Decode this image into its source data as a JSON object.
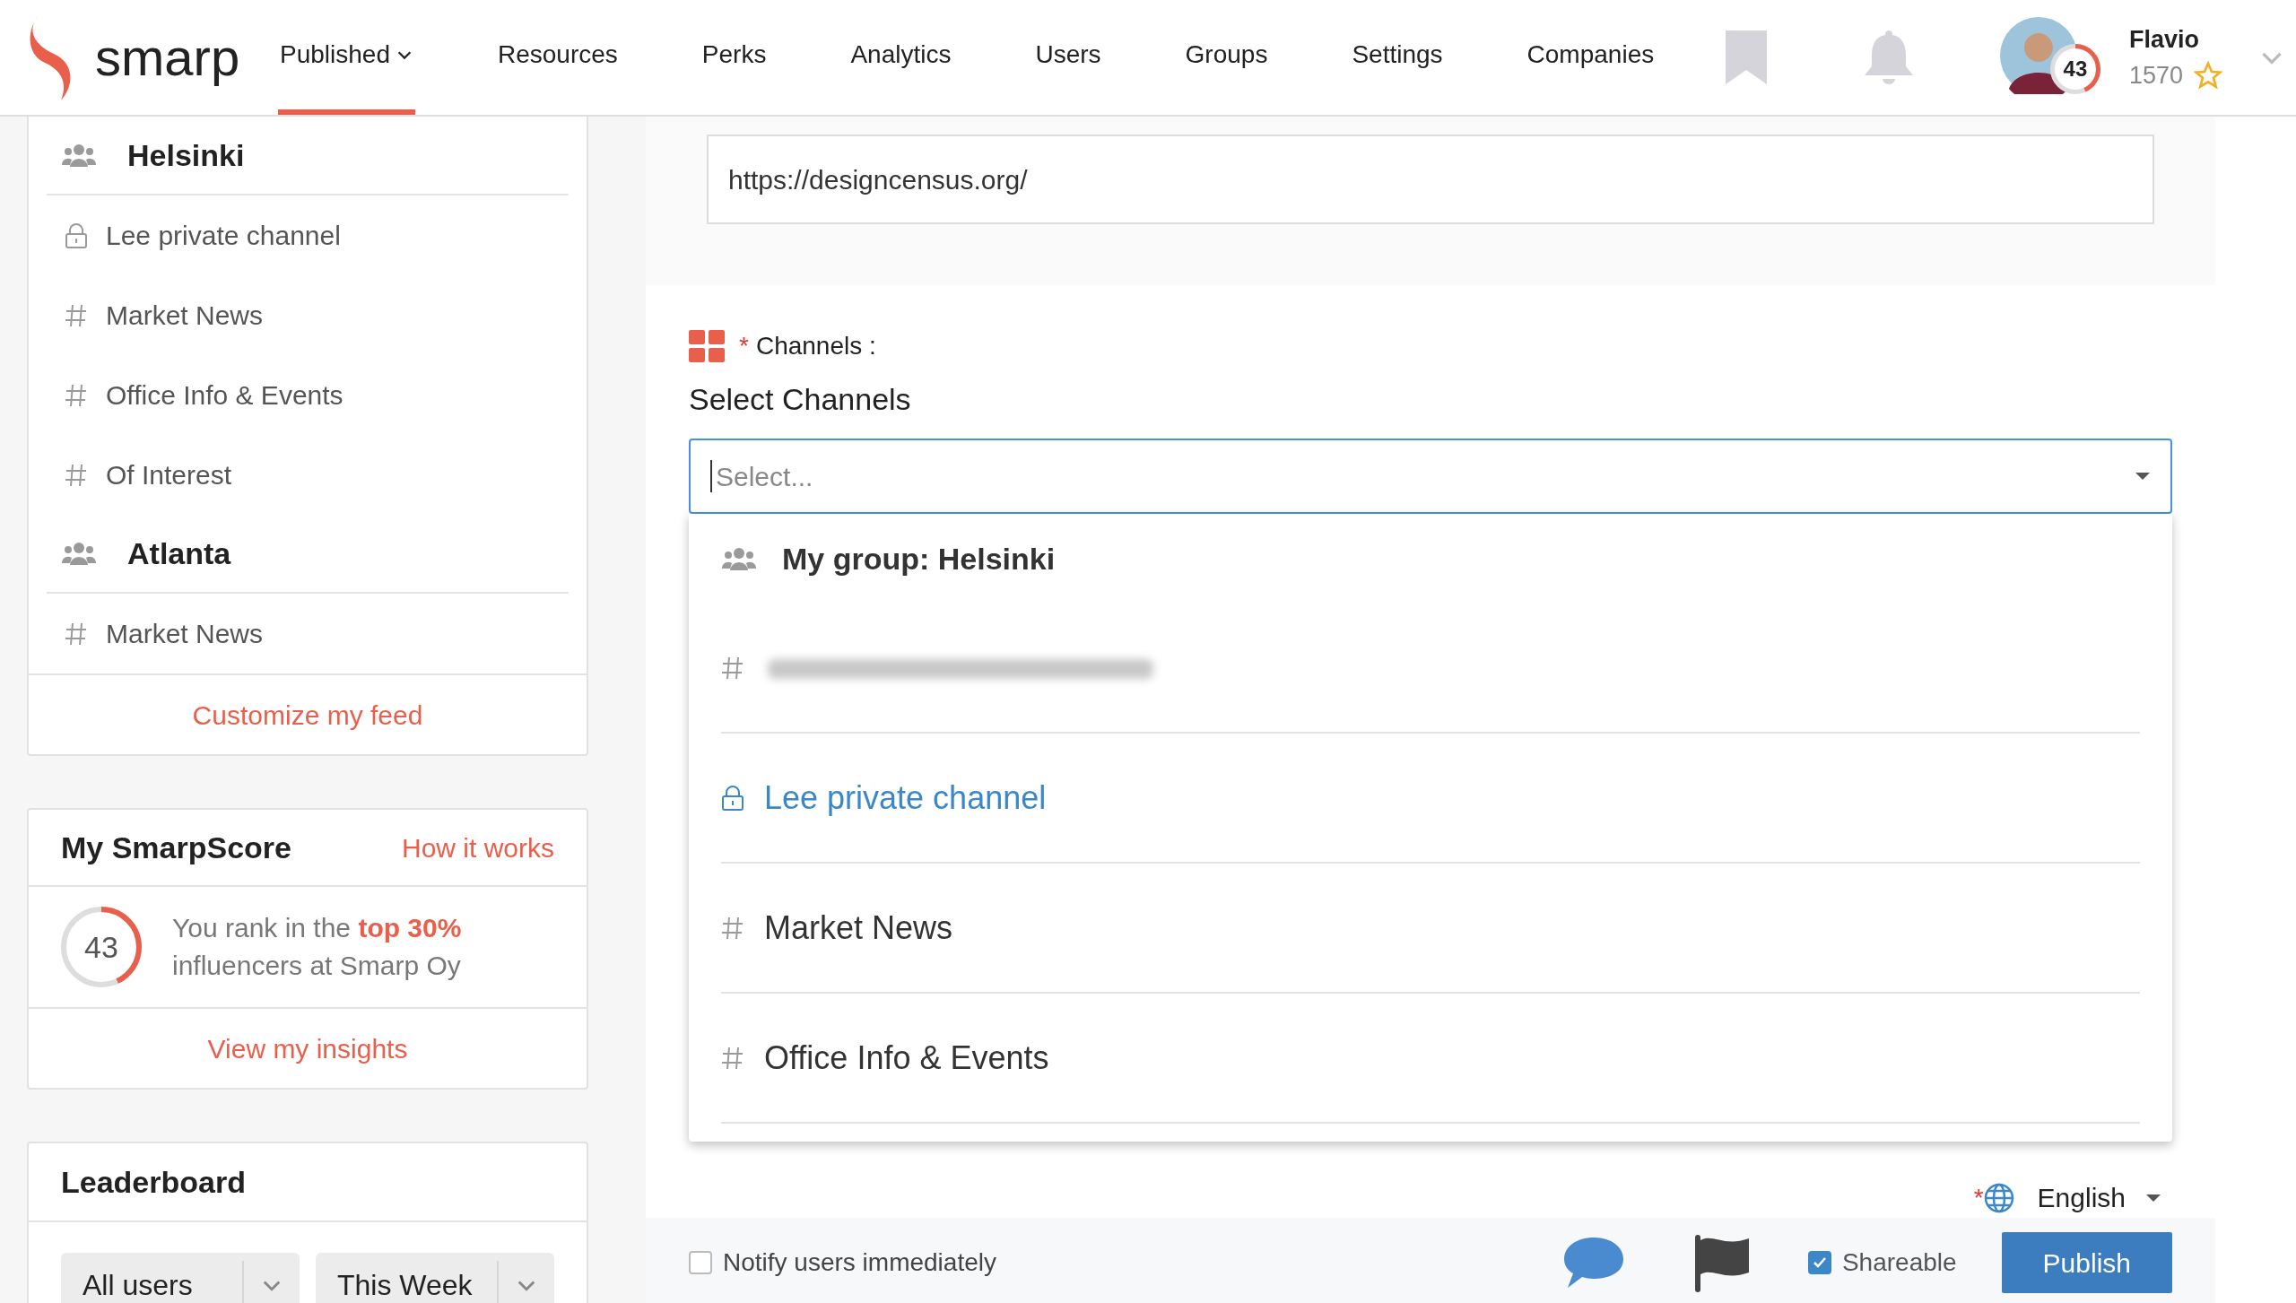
{
  "header": {
    "logo": "smarp",
    "nav": [
      {
        "label": "Published",
        "selected": true,
        "dropdown": true
      },
      {
        "label": "Resources",
        "selected": false,
        "dropdown": false
      },
      {
        "label": "Perks",
        "selected": false,
        "dropdown": false
      },
      {
        "label": "Analytics",
        "selected": false,
        "dropdown": false
      },
      {
        "label": "Users",
        "selected": false,
        "dropdown": false
      },
      {
        "label": "Groups",
        "selected": false,
        "dropdown": false
      },
      {
        "label": "Settings",
        "selected": false,
        "dropdown": false
      },
      {
        "label": "Companies",
        "selected": false,
        "dropdown": false
      }
    ],
    "user": {
      "name": "Flavio",
      "score": "43",
      "level": 0.43,
      "points": "1570"
    }
  },
  "sidebar": {
    "feed": [
      {
        "kind": "group",
        "label": "Helsinki"
      },
      {
        "kind": "private",
        "label": "Lee private channel"
      },
      {
        "kind": "channel",
        "label": "Market News"
      },
      {
        "kind": "channel",
        "label": "Office Info & Events"
      },
      {
        "kind": "channel",
        "label": "Of Interest"
      },
      {
        "kind": "group",
        "label": "Atlanta"
      },
      {
        "kind": "channel",
        "label": "Market News"
      }
    ],
    "customize_link": "Customize my feed",
    "smarpscore": {
      "title": "My SmarpScore",
      "how_link": "How it works",
      "score": "43",
      "level": 0.43,
      "text": "You rank in the **top 30%** influencers at Smarp Oy",
      "insights_link": "View my insights"
    },
    "leaderboard": {
      "title": "Leaderboard",
      "filters": [
        "All users",
        "This Week"
      ]
    }
  },
  "form": {
    "url": "https://designcensus.org/",
    "channels_required_mark": "*",
    "channels_label": "Channels :",
    "select_label": "Select Channels",
    "select_placeholder": "Select...",
    "options": [
      {
        "kind": "group",
        "label": "My group: Helsinki"
      },
      {
        "kind": "redacted"
      },
      {
        "kind": "private",
        "label": "Lee private channel",
        "highlighted": true
      },
      {
        "kind": "channel",
        "label": "Market News",
        "highlighted": false
      },
      {
        "kind": "channel",
        "label": "Office Info & Events",
        "highlighted": false
      }
    ],
    "language_required_mark": "*",
    "language": "English",
    "notify": {
      "label": "Notify users immediately",
      "checked": false
    },
    "shareable": {
      "label": "Shareable",
      "checked": true
    },
    "publish": "Publish"
  }
}
